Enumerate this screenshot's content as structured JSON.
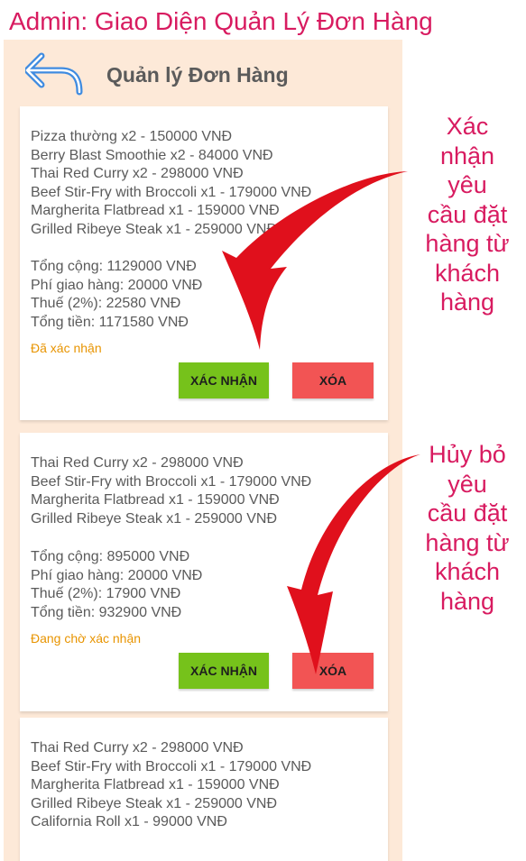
{
  "doc_title": "Admin: Giao Diện Quản Lý Đơn Hàng",
  "header": {
    "back_icon": "back-arrow-icon",
    "title": "Quản lý Đơn Hàng"
  },
  "orders": [
    {
      "items": [
        "Pizza thường x2 - 150000 VNĐ",
        "Berry Blast Smoothie x2 - 84000 VNĐ",
        "Thai Red Curry x2 - 298000 VNĐ",
        "Beef Stir-Fry with Broccoli x1 - 179000 VNĐ",
        "Margherita Flatbread x1 - 159000 VNĐ",
        "Grilled Ribeye Steak x1 - 259000 VNĐ"
      ],
      "subtotal": "Tổng cộng: 1129000 VNĐ",
      "shipping": "Phí giao hàng: 20000 VNĐ",
      "tax": "Thuế (2%): 22580 VNĐ",
      "total": "Tổng tiền: 1171580 VNĐ",
      "status": "Đã xác nhận",
      "confirm_label": "XÁC NHẬN",
      "delete_label": "XÓA"
    },
    {
      "items": [
        "Thai Red Curry x2 - 298000 VNĐ",
        "Beef Stir-Fry with Broccoli x1 - 179000 VNĐ",
        "Margherita Flatbread x1 - 159000 VNĐ",
        "Grilled Ribeye Steak x1 - 259000 VNĐ"
      ],
      "subtotal": "Tổng cộng: 895000 VNĐ",
      "shipping": "Phí giao hàng: 20000 VNĐ",
      "tax": "Thuế (2%): 17900 VNĐ",
      "total": "Tổng tiền: 932900 VNĐ",
      "status": "Đang chờ xác nhận",
      "confirm_label": "XÁC NHẬN",
      "delete_label": "XÓA"
    },
    {
      "items": [
        "Thai Red Curry x2 - 298000 VNĐ",
        "Beef Stir-Fry with Broccoli x1 - 179000 VNĐ",
        "Margherita Flatbread x1 - 159000 VNĐ",
        "Grilled Ribeye Steak x1 - 259000 VNĐ",
        "California Roll x1 - 99000 VNĐ"
      ]
    }
  ],
  "annotations": {
    "confirm_note": [
      "Xác",
      "nhận",
      "yêu",
      "cầu đặt",
      "hàng từ",
      "khách",
      "hàng"
    ],
    "cancel_note": [
      "Hủy bỏ",
      "yêu",
      "cầu đặt",
      "hàng từ",
      "khách",
      "hàng"
    ]
  },
  "colors": {
    "accent": "#d81b60",
    "confirm_button": "#76c21b",
    "delete_button": "#f25454",
    "status_text": "#e89400",
    "phone_background": "#fde9d8",
    "arrow": "#e0101c"
  }
}
